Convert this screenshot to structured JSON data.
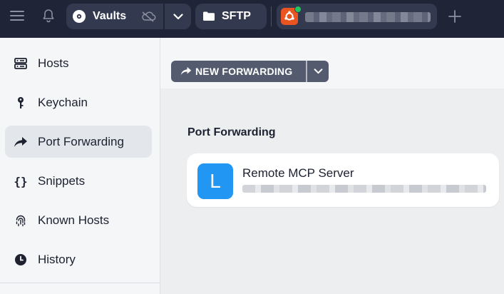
{
  "topbar": {
    "vault": {
      "label": "Vaults"
    },
    "sftp": {
      "label": "SFTP"
    },
    "host_tab": {
      "name": "",
      "os": "ubuntu",
      "status_color": "#22c55e"
    }
  },
  "sidebar": {
    "items": [
      {
        "label": "Hosts",
        "icon": "server-icon",
        "active": false
      },
      {
        "label": "Keychain",
        "icon": "key-icon",
        "active": false
      },
      {
        "label": "Port Forwarding",
        "icon": "forward-icon",
        "active": true
      },
      {
        "label": "Snippets",
        "icon": "braces-icon",
        "active": false
      },
      {
        "label": "Known Hosts",
        "icon": "fingerprint-icon",
        "active": false
      },
      {
        "label": "History",
        "icon": "clock-icon",
        "active": false
      }
    ]
  },
  "toolbar": {
    "new_forwarding_label": "NEW FORWARDING"
  },
  "main": {
    "section_title": "Port Forwarding",
    "rules": [
      {
        "avatar_letter": "L",
        "name": "Remote MCP Server",
        "detail": "",
        "avatar_color": "#2196f3"
      }
    ]
  },
  "colors": {
    "topbar": "#1f2437",
    "pill": "#333a4f",
    "accent": "#2196f3",
    "ubuntu": "#e95420"
  }
}
